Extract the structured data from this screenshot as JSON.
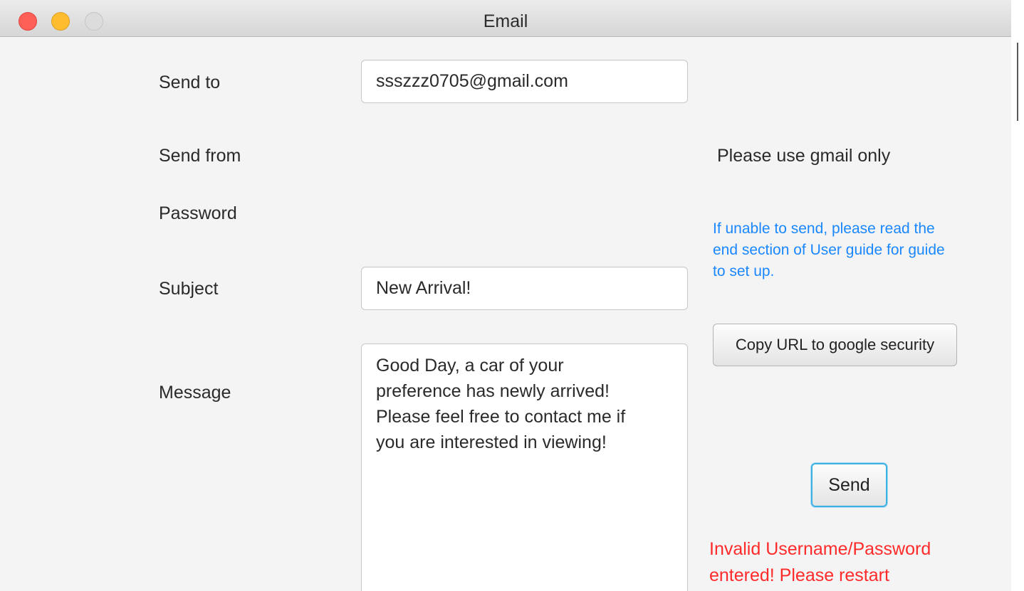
{
  "window": {
    "title": "Email"
  },
  "form": {
    "send_to": {
      "label": "Send to",
      "value": "ssszzz0705@gmail.com"
    },
    "send_from": {
      "label": "Send from"
    },
    "password": {
      "label": "Password"
    },
    "subject": {
      "label": "Subject",
      "value": "New Arrival!"
    },
    "message": {
      "label": "Message",
      "value": "Good Day, a car of your\npreference has newly arrived!\nPlease feel free to contact me if\nyou are interested in viewing!"
    }
  },
  "side": {
    "gmail_hint": "Please use gmail only",
    "guide_hint": "If unable to send, please read the end section of User guide for guide to set up.",
    "copy_url_button": "Copy URL to google security",
    "send_button": "Send",
    "error_message": "Invalid Username/Password entered! Please restart"
  },
  "colors": {
    "hint_blue": "#1a87ff",
    "error_red": "#ff2a2a",
    "focus_ring": "#3fb0e5",
    "traffic_close": "#fe5f57",
    "traffic_minimize": "#febc2e",
    "traffic_zoom": "#dcdcdc"
  }
}
